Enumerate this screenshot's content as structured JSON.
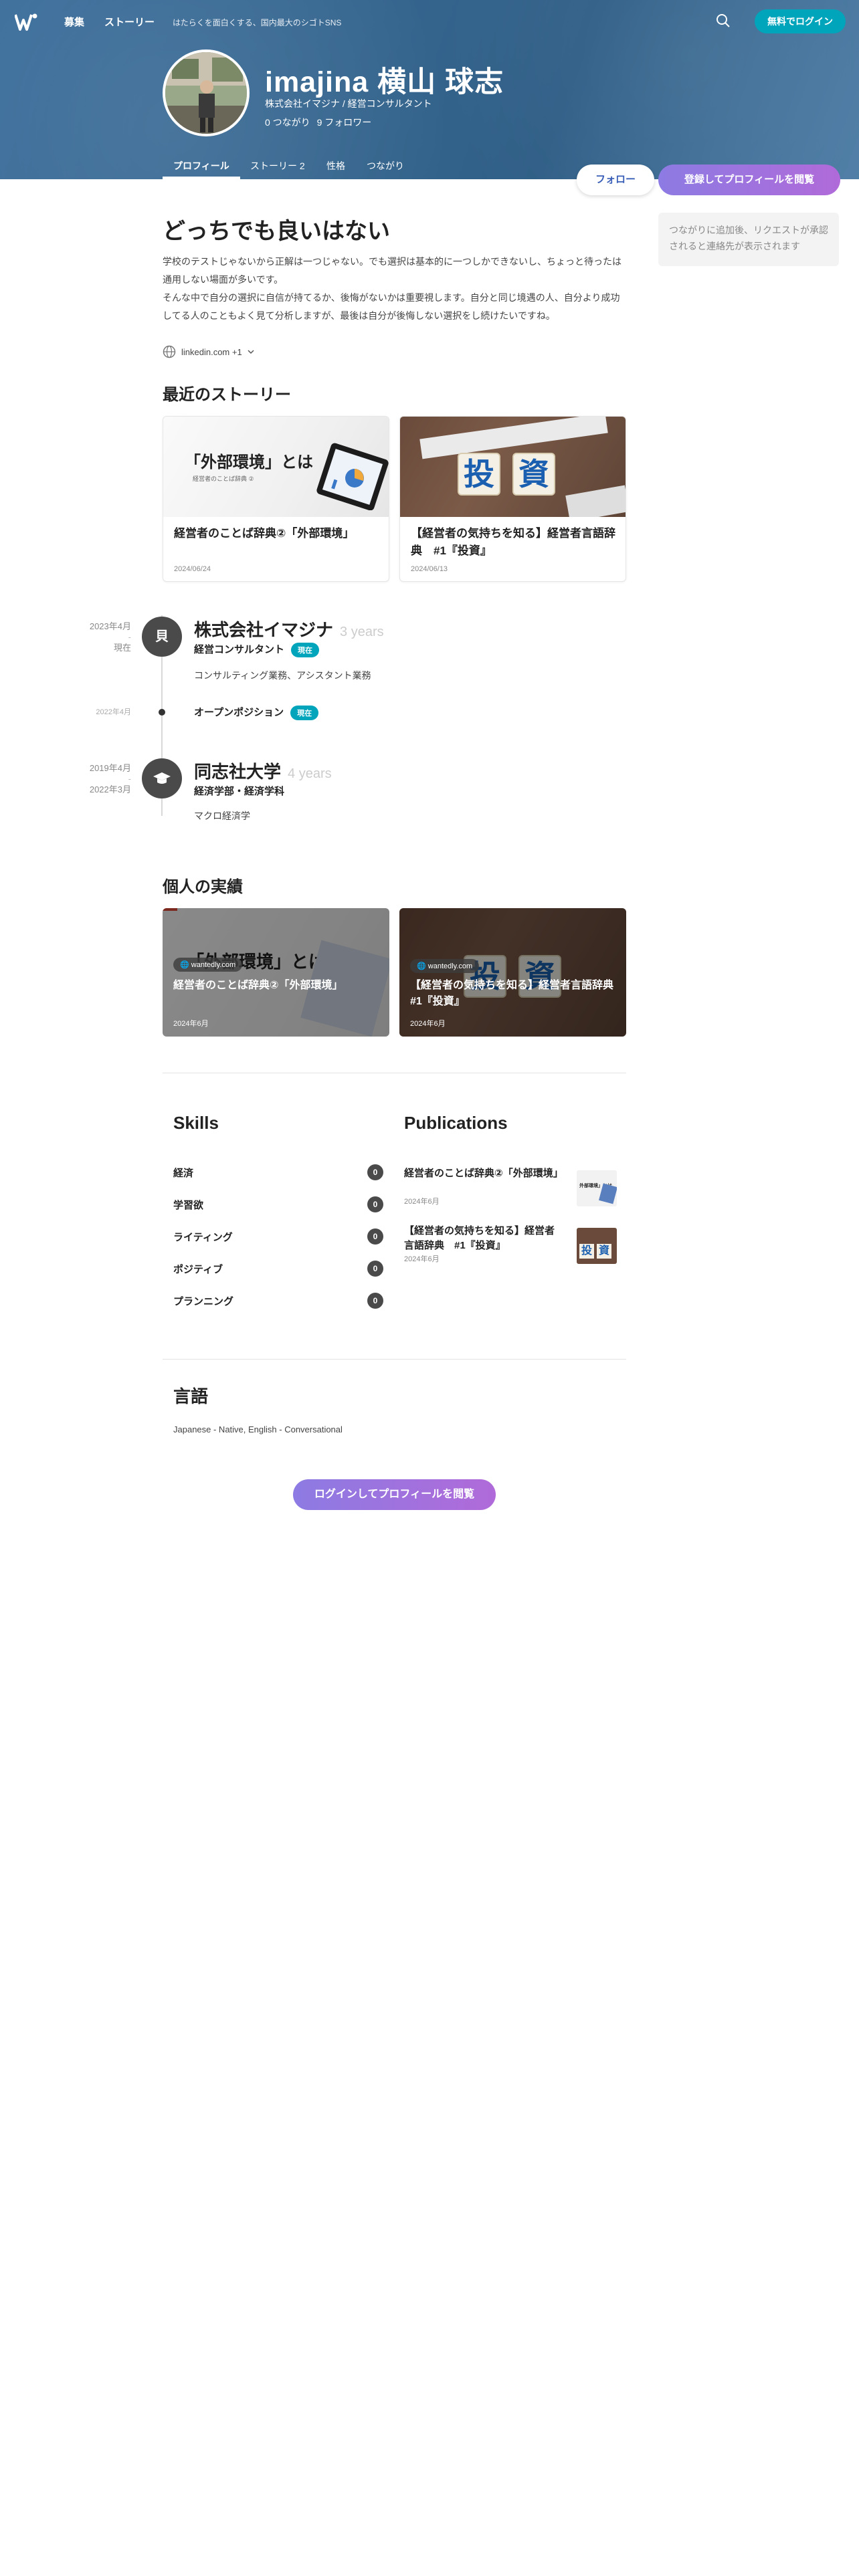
{
  "nav": {
    "items": [
      "募集",
      "ストーリー"
    ],
    "tagline": "はたらくを面白くする、国内最大のシゴトSNS",
    "login_label": "無料でログイン"
  },
  "profile": {
    "name": "imajina 横山 球志",
    "title": "株式会社イマジナ / 経営コンサルタント",
    "connections": "0 つながり",
    "followers": "9 フォロワー",
    "tabs": [
      "プロフィール",
      "ストーリー 2",
      "性格",
      "つながり"
    ],
    "follow_label": "フォロー",
    "view_label": "登録してプロフィールを閲覧"
  },
  "sidebar": {
    "note": "つながりに追加後、リクエストが承認されると連絡先が表示されます"
  },
  "intro": {
    "heading": "どっちでも良いはない",
    "body_line1": "学校のテストじゃないから正解は一つじゃない。でも選択は基本的に一つしかできないし、ちょっと待ったは通用しない場面が多いです。",
    "body_line2": "そんな中で自分の選択に自信が持てるか、後悔がないかは重要視します。自分と同じ境遇の人、自分より成功してる人のこともよく見て分析しますが、最後は自分が後悔しない選択をし続けたいですね。",
    "link": "linkedin.com +1"
  },
  "stories": {
    "heading": "最近のストーリー",
    "items": [
      {
        "title": "経営者のことば辞典②「外部環境」",
        "date": "2024/06/24",
        "thumb_text": "「外部環境」とは",
        "thumb_sub": "経営者のことば辞典 ②"
      },
      {
        "title": "【経営者の気持ちを知る】経営者言語辞典　#1『投資』",
        "date": "2024/06/13",
        "thumb_text": "投資"
      }
    ]
  },
  "timeline": {
    "entries": [
      {
        "start": "2023年4月",
        "end": "現在",
        "icon": "building-icon",
        "icon_char": "貝",
        "org": "株式会社イマジナ",
        "duration": "3 years",
        "role": "経営コンサルタント",
        "badge": "現在",
        "desc": "コンサルティング業務、アシスタント業務"
      },
      {
        "start": "2022年4月",
        "role": "オープンポジション",
        "badge": "現在"
      },
      {
        "start": "2019年4月",
        "end": "2022年3月",
        "icon": "graduation-cap-icon",
        "icon_char": "🎓",
        "org": "同志社大学",
        "duration": "4 years",
        "role": "経済学部・経済学科",
        "desc": "マクロ経済学"
      }
    ]
  },
  "achievements": {
    "heading": "個人の実績",
    "items": [
      {
        "source": "wantedly.com",
        "title": "経営者のことば辞典②「外部環境」",
        "date": "2024年6月",
        "thumb_text": "「外部環境」とは"
      },
      {
        "source": "wantedly.com",
        "title": "【経営者の気持ちを知る】経営者言語辞典　#1『投資』",
        "date": "2024年6月"
      }
    ]
  },
  "skills": {
    "heading": "Skills",
    "items": [
      {
        "label": "経済",
        "count": "0"
      },
      {
        "label": "学習欲",
        "count": "0"
      },
      {
        "label": "ライティング",
        "count": "0"
      },
      {
        "label": "ポジティブ",
        "count": "0"
      },
      {
        "label": "プランニング",
        "count": "0"
      }
    ]
  },
  "publications": {
    "heading": "Publications",
    "items": [
      {
        "title": "経営者のことば辞典②「外部環境」",
        "date": "2024年6月"
      },
      {
        "title": "【経営者の気持ちを知る】経営者言語辞典　#1『投資』",
        "date": "2024年6月"
      }
    ]
  },
  "languages": {
    "heading": "言語",
    "text": "Japanese - Native, English - Conversational"
  },
  "footer": {
    "button_label": "ログインしてプロフィールを閲覧"
  },
  "colors": {
    "accent": "#00a4bb",
    "cta_gradient_start": "#8d7be3",
    "cta_gradient_end": "#b06ad9"
  }
}
